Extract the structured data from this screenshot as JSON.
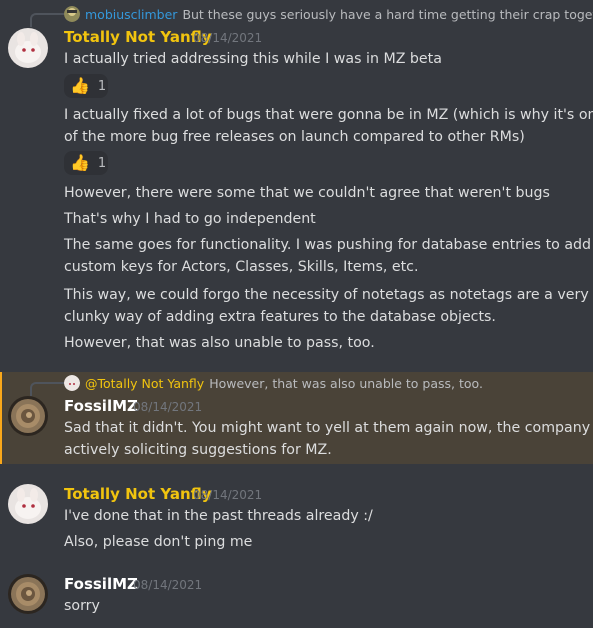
{
  "colors": {
    "background": "#36393f",
    "yanfly_name": "#f1c40f",
    "fossil_name": "#ffffff",
    "reply_author": "#3498db",
    "mention": "#c9cdfb",
    "timestamp": "#72767d",
    "highlight_bg": "#4a4338",
    "highlight_bar": "#faa81a"
  },
  "messages": [
    {
      "reply": {
        "author": "mobiusclimber",
        "text": "But these guys seriously have a hard time getting their crap togeth..."
      },
      "author": "Totally Not Yanfly",
      "timestamp": "08/14/2021",
      "lines": [
        "I actually tried addressing this while I was in MZ beta",
        "I actually fixed a lot of bugs that were gonna be in MZ (which is why it's one",
        "of the more bug free releases on launch compared to other RMs)",
        "However, there were some that we couldn't agree that weren't bugs",
        "That's why I had to go independent",
        "The same goes for functionality. I was pushing for database entries to add in",
        "custom keys for Actors, Classes, Skills, Items, etc.",
        "This way, we could forgo the necessity of notetags as notetags are a very",
        "clunky way of adding extra features to the database objects.",
        "However, that was also unable to pass, too."
      ],
      "reactions": [
        {
          "icon": "thumbs-up-icon",
          "count": "1"
        },
        {
          "icon": "thumbs-up-icon",
          "count": "1"
        }
      ]
    },
    {
      "reply": {
        "author": "@Totally Not Yanfly",
        "text": "However, that was also unable to pass, too."
      },
      "author": "FossilMZ",
      "timestamp": "08/14/2021",
      "lines": [
        "Sad that it didn't.  You might want to yell at them again now, the company is",
        "actively soliciting suggestions for MZ."
      ]
    },
    {
      "author": "Totally Not Yanfly",
      "timestamp": "08/14/2021",
      "lines": [
        "I've done that in the past threads already :/",
        "Also, please don't ping me"
      ]
    },
    {
      "author": "FossilMZ",
      "timestamp": "08/14/2021",
      "lines": [
        "sorry"
      ]
    }
  ]
}
